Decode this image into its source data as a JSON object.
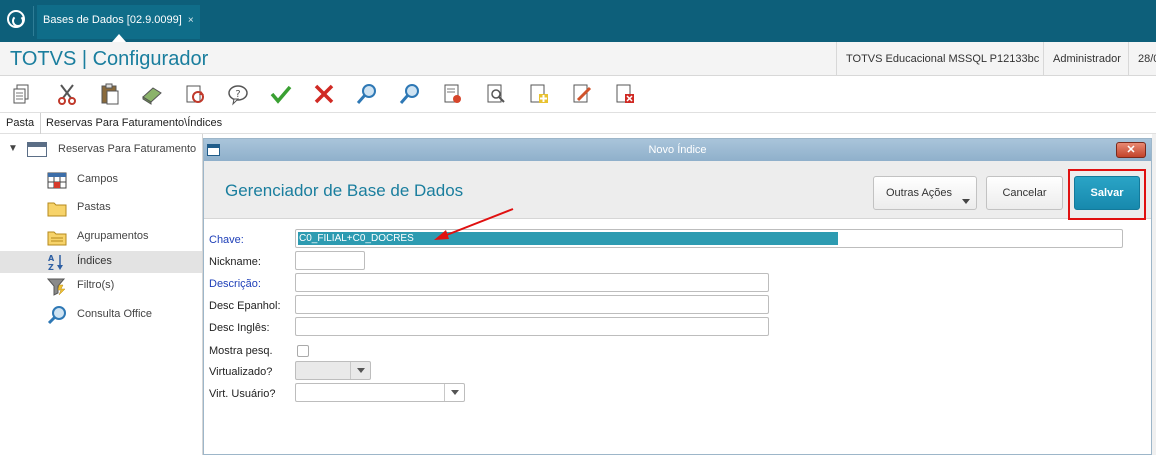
{
  "topbar": {
    "logo_icon": "totvs-logo-icon",
    "tab_label": "Bases de Dados [02.9.0099]",
    "tab_close": "×"
  },
  "header": {
    "app_title": "TOTVS | Configurador",
    "environment": "TOTVS Educacional MSSQL P12133bc",
    "user": "Administrador",
    "date": "28/0"
  },
  "toolbar": {
    "icons": [
      "copy-icon",
      "cut-icon",
      "paste-icon",
      "eraser-icon",
      "refresh-icon",
      "help-icon",
      "confirm-icon",
      "cancel-icon",
      "search-icon",
      "search-next-icon",
      "import-icon",
      "preview-icon",
      "add-icon",
      "edit-icon",
      "delete-icon"
    ]
  },
  "breadcrumb": {
    "pasta": "Pasta",
    "path": "Reservas Para Faturamento\\Índices"
  },
  "tree": {
    "root": "Reservas Para Faturamento",
    "items": [
      {
        "label": "Campos",
        "icon": "table-icon"
      },
      {
        "label": "Pastas",
        "icon": "folder-icon"
      },
      {
        "label": "Agrupamentos",
        "icon": "group-folder-icon"
      },
      {
        "label": "Índices",
        "icon": "sort-az-icon"
      },
      {
        "label": "Filtro(s)",
        "icon": "filter-icon"
      },
      {
        "label": "Consulta Office",
        "icon": "magnifier-icon"
      }
    ]
  },
  "dialog": {
    "title": "Novo Índice",
    "close": "✕",
    "heading": "Gerenciador de Base de Dados",
    "btn_outras": "Outras Ações",
    "btn_cancelar": "Cancelar",
    "btn_salvar": "Salvar"
  },
  "form": {
    "chave_label": "Chave:",
    "chave_value": "C0_FILIAL+C0_DOCRES",
    "nickname_label": "Nickname:",
    "descricao_label": "Descrição:",
    "desc_espanhol_label": "Desc Epanhol:",
    "desc_ingles_label": "Desc Inglês:",
    "mostra_pesq_label": "Mostra pesq.",
    "virtualizado_label": "Virtualizado?",
    "virt_usuario_label": "Virt. Usuário?"
  },
  "colors": {
    "brand": "#0d5f7a",
    "accent": "#1a7e9e",
    "primary_button": "#1789ad",
    "highlight": "#e01010"
  }
}
